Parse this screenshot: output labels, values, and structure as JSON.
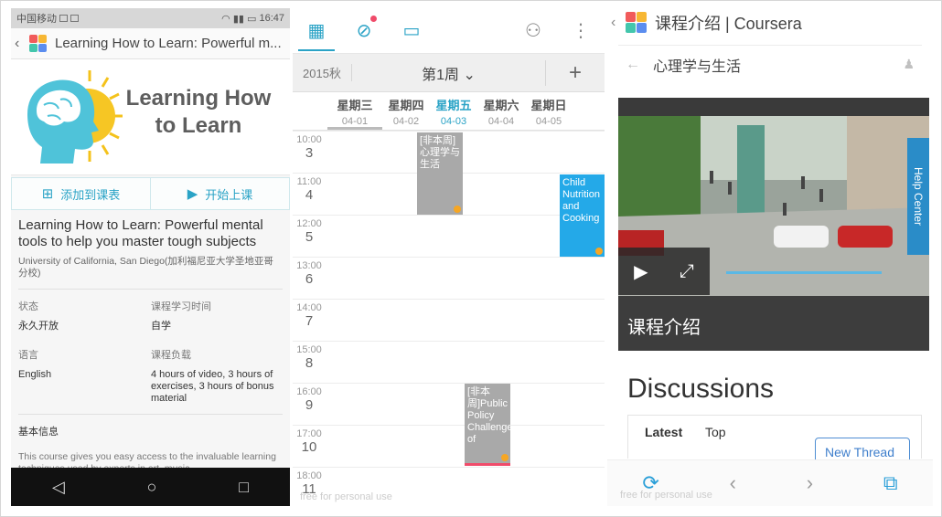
{
  "panel1": {
    "status": {
      "carrier": "中国移动",
      "time": "16:47"
    },
    "appbar": {
      "back": "‹",
      "title": "Learning How to Learn: Powerful m..."
    },
    "hero": {
      "title": "Learning How to Learn"
    },
    "actions": {
      "add": "添加到课表",
      "start": "开始上课"
    },
    "course": {
      "name": "Learning How to Learn: Powerful mental tools to help you master tough subjects",
      "university": "University of California, San Diego(加利福尼亚大学圣地亚哥分校)",
      "fields": [
        {
          "label": "状态",
          "value": "永久开放"
        },
        {
          "label": "课程学习时间",
          "value": "自学"
        },
        {
          "label": "语言",
          "value": "English"
        },
        {
          "label": "课程负载",
          "value": "4 hours of video, 3 hours of exercises, 3 hours of bonus material"
        }
      ],
      "section": "基本信息",
      "description": "This course gives you easy access to the invaluable learning techniques used by experts in art, music,"
    },
    "navbar": {
      "back": "◁",
      "home": "○",
      "recent": "□"
    }
  },
  "panel2": {
    "week": {
      "semester": "2015秋",
      "label": "第1周 ⌄",
      "add": "+"
    },
    "days": [
      {
        "name": "星期三",
        "date": "04-01"
      },
      {
        "name": "星期四",
        "date": "04-02"
      },
      {
        "name": "星期五",
        "date": "04-03"
      },
      {
        "name": "星期六",
        "date": "04-04"
      },
      {
        "name": "星期日",
        "date": "04-05"
      }
    ],
    "times": [
      {
        "time": "10:00",
        "num": "3"
      },
      {
        "time": "11:00",
        "num": "4"
      },
      {
        "time": "12:00",
        "num": "5"
      },
      {
        "time": "13:00",
        "num": "6"
      },
      {
        "time": "14:00",
        "num": "7"
      },
      {
        "time": "15:00",
        "num": "8"
      },
      {
        "time": "16:00",
        "num": "9"
      },
      {
        "time": "17:00",
        "num": "10"
      },
      {
        "time": "18:00",
        "num": "11"
      }
    ],
    "events": {
      "e1": "[非本周]心理学与生活",
      "e2": "Child Nutrition and Cooking",
      "e3": "[非本周]Public Policy Challenges of"
    },
    "watermark": "free for personal use"
  },
  "panel3": {
    "appbar": {
      "back": "‹",
      "title": "课程介绍 | Coursera"
    },
    "subheader": {
      "title": "心理学与生活"
    },
    "video": {
      "caption": "课程介绍",
      "help": "Help Center"
    },
    "discussions": "Discussions",
    "tabs": {
      "latest": "Latest",
      "top": "Top"
    },
    "new_thread": "New Thread",
    "watermark": "free for personal use"
  }
}
